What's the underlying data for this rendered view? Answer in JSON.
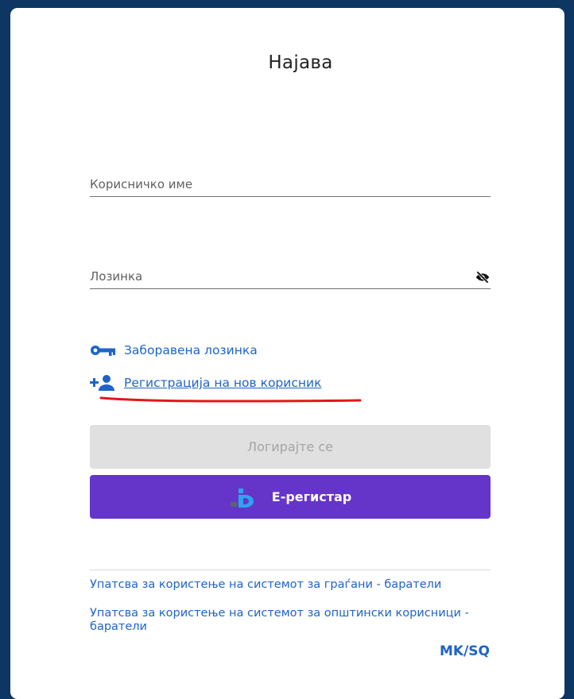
{
  "login": {
    "title": "Најава",
    "username_placeholder": "Корисничко име",
    "password_placeholder": "Лозинка",
    "forgot_password": "Заборавена лозинка",
    "register_new_user": "Регистрација на нов корисник",
    "login_button": "Логирајте се",
    "eregister_button": "Е-регистар",
    "guide_citizens": "Упатсва за користење на системот за граѓани - баратели",
    "guide_municipal": "Упатсва за користење на системот за општински корисници - баратели",
    "lang_mk": "MK",
    "lang_sep": "/",
    "lang_sq": "SQ"
  },
  "colors": {
    "page_background": "#0e3663",
    "link": "#1e64c8",
    "login_button_disabled": "#e0e0e0",
    "eregister_button": "#6535c9",
    "annotation_underline": "#e3161b"
  },
  "icons": {
    "password_toggle": "eye-off-icon",
    "forgot_password": "key-icon",
    "register": "add-user-icon",
    "eregister": "eregister-logo-icon"
  }
}
